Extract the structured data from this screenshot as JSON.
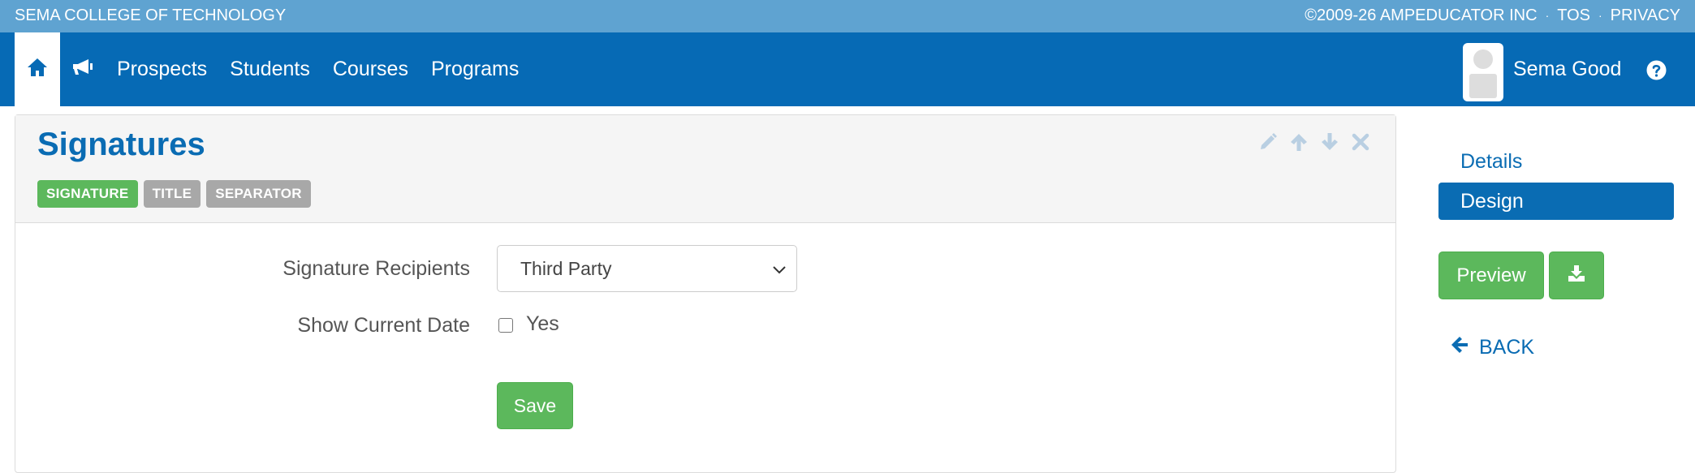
{
  "topbar": {
    "school_name": "SEMA COLLEGE OF TECHNOLOGY",
    "copyright": "©2009-26 AMPEDUCATOR INC",
    "tos": "TOS",
    "privacy": "PRIVACY",
    "separator": "·"
  },
  "nav": {
    "icons": [
      "home-icon",
      "bullhorn-icon"
    ],
    "links": [
      "Prospects",
      "Students",
      "Courses",
      "Programs"
    ],
    "user_name": "Sema Good",
    "help_icon": "question-circle-icon"
  },
  "card": {
    "title": "Signatures",
    "tags": [
      {
        "label": "SIGNATURE",
        "active": true
      },
      {
        "label": "TITLE",
        "active": false
      },
      {
        "label": "SEPARATOR",
        "active": false
      }
    ],
    "tools": [
      "pencil-icon",
      "arrow-up-icon",
      "arrow-down-icon",
      "close-icon"
    ]
  },
  "form": {
    "signature_recipients_label": "Signature Recipients",
    "signature_recipients_value": "Third Party",
    "show_current_date_label": "Show Current Date",
    "show_current_date_option": "Yes",
    "show_current_date_checked": false,
    "save_label": "Save"
  },
  "sidebar": {
    "details": "Details",
    "design": "Design",
    "preview": "Preview",
    "back": "BACK"
  },
  "colors": {
    "topbar": "#5fa3d1",
    "navbar": "#066ab5",
    "accent": "#0a6cb3",
    "success": "#5cb85c",
    "tag_inactive": "#a8a8a8"
  }
}
